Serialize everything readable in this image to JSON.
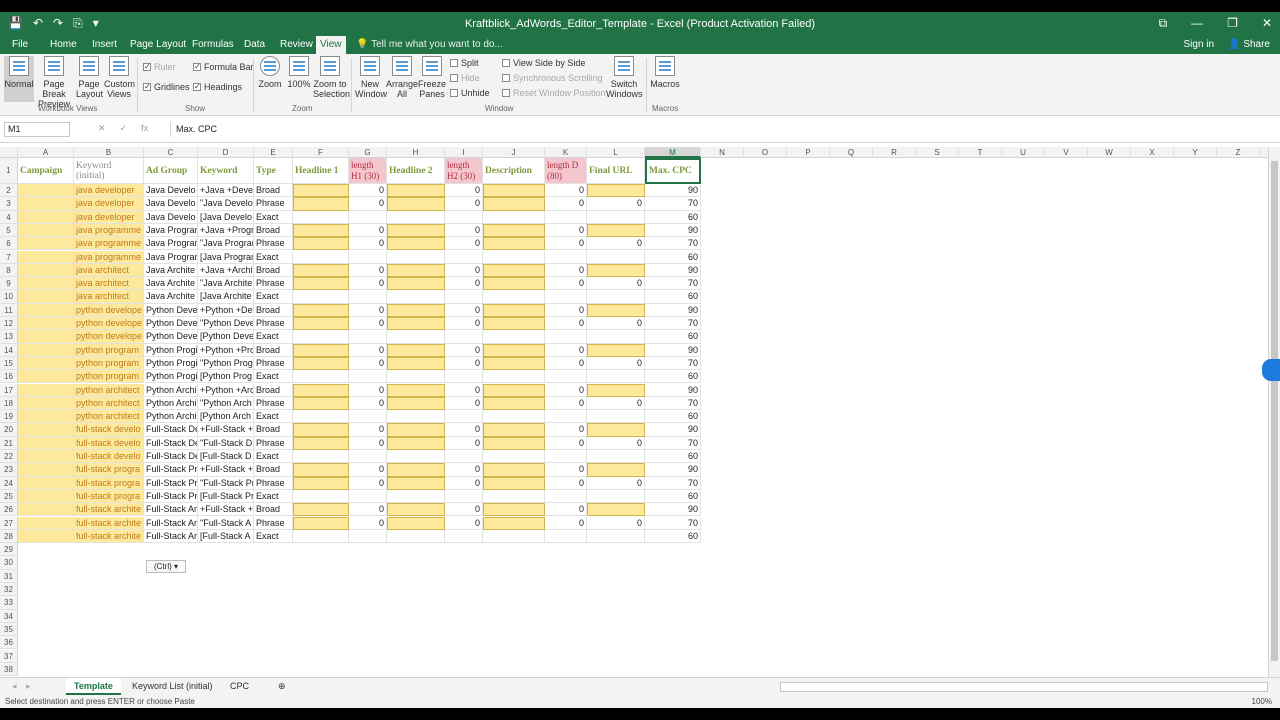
{
  "window": {
    "title": "Kraftblick_AdWords_Editor_Template - Excel (Product Activation Failed)",
    "qat": [
      "💾",
      "↶",
      "↷",
      "⎘",
      "▾"
    ],
    "controls": [
      "⧉",
      "—",
      "❐",
      "✕"
    ]
  },
  "menu": {
    "tabs": [
      "File",
      "Home",
      "Insert",
      "Page Layout",
      "Formulas",
      "Data",
      "Review",
      "View"
    ],
    "active": "View",
    "tell_me": "Tell me what you want to do...",
    "sign_in": "Sign in",
    "share": "Share"
  },
  "ribbon": {
    "workbook_views": [
      "Normal",
      "Page Break Preview",
      "Page Layout",
      "Custom Views"
    ],
    "show": {
      "ruler": "Ruler",
      "formula_bar": "Formula Bar",
      "gridlines": "Gridlines",
      "headings": "Headings"
    },
    "zoom": [
      "Zoom",
      "100%",
      "Zoom to Selection"
    ],
    "window_big": [
      "New Window",
      "Arrange All",
      "Freeze Panes"
    ],
    "window_small": [
      "Split",
      "Hide",
      "Unhide"
    ],
    "window_side": [
      "View Side by Side",
      "Synchronous Scrolling",
      "Reset Window Position"
    ],
    "switch": "Switch Windows",
    "macros": "Macros",
    "groups": [
      "Workbook Views",
      "Show",
      "Zoom",
      "Window",
      "Macros"
    ]
  },
  "formula_bar": {
    "name_box": "M1",
    "content": "Max. CPC",
    "icons": [
      "✕",
      "✓",
      "fx"
    ]
  },
  "columns": [
    "A",
    "B",
    "C",
    "D",
    "E",
    "F",
    "G",
    "H",
    "I",
    "J",
    "K",
    "L",
    "M",
    "N",
    "O",
    "P",
    "Q",
    "R",
    "S",
    "T",
    "U",
    "V",
    "W",
    "X",
    "Y",
    "Z"
  ],
  "headers": {
    "A": "Campaign",
    "B": "Keyword (initial)",
    "C": "Ad Group",
    "D": "Keyword",
    "E": "Type",
    "F": "Headline 1",
    "G": "length H1 (30)",
    "H": "Headline 2",
    "I": "length H2 (30)",
    "J": "Description",
    "K": "length D (80)",
    "L": "Final URL",
    "M": "Max. CPC"
  },
  "rows": [
    {
      "b": "java developer",
      "c": "Java Develo",
      "d": "+Java +Devel",
      "e": "Broad",
      "g": "0",
      "i": "0",
      "k": "0",
      "l": "",
      "m": "90"
    },
    {
      "b": "java developer",
      "c": "Java Develo",
      "d": "\"Java Develo",
      "e": "Phrase",
      "g": "0",
      "i": "0",
      "k": "0",
      "l": "0",
      "m": "70"
    },
    {
      "b": "java developer",
      "c": "Java Develo",
      "d": "[Java Develo",
      "e": "Exact",
      "g": "",
      "i": "",
      "k": "",
      "l": "",
      "m": "60"
    },
    {
      "b": "java programme",
      "c": "Java Progran",
      "d": "+Java +Progr",
      "e": "Broad",
      "g": "0",
      "i": "0",
      "k": "0",
      "l": "",
      "m": "90"
    },
    {
      "b": "java programme",
      "c": "Java Progran",
      "d": "\"Java Progran",
      "e": "Phrase",
      "g": "0",
      "i": "0",
      "k": "0",
      "l": "0",
      "m": "70"
    },
    {
      "b": "java programme",
      "c": "Java Progran",
      "d": "[Java Progran",
      "e": "Exact",
      "g": "",
      "i": "",
      "k": "",
      "l": "",
      "m": "60"
    },
    {
      "b": "java architect",
      "c": "Java Archite",
      "d": "+Java +Archit",
      "e": "Broad",
      "g": "0",
      "i": "0",
      "k": "0",
      "l": "",
      "m": "90"
    },
    {
      "b": "java architect",
      "c": "Java Archite",
      "d": "\"Java Archite",
      "e": "Phrase",
      "g": "0",
      "i": "0",
      "k": "0",
      "l": "0",
      "m": "70"
    },
    {
      "b": "java architect",
      "c": "Java Archite",
      "d": "[Java Archite",
      "e": "Exact",
      "g": "",
      "i": "",
      "k": "",
      "l": "",
      "m": "60"
    },
    {
      "b": "python develope",
      "c": "Python Deve",
      "d": "+Python +Dev",
      "e": "Broad",
      "g": "0",
      "i": "0",
      "k": "0",
      "l": "",
      "m": "90"
    },
    {
      "b": "python develope",
      "c": "Python Deve",
      "d": "\"Python Deve",
      "e": "Phrase",
      "g": "0",
      "i": "0",
      "k": "0",
      "l": "0",
      "m": "70"
    },
    {
      "b": "python develope",
      "c": "Python Deve",
      "d": "[Python Deve",
      "e": "Exact",
      "g": "",
      "i": "",
      "k": "",
      "l": "",
      "m": "60"
    },
    {
      "b": "python program",
      "c": "Python Progi",
      "d": "+Python +Pro",
      "e": "Broad",
      "g": "0",
      "i": "0",
      "k": "0",
      "l": "",
      "m": "90"
    },
    {
      "b": "python program",
      "c": "Python Progi",
      "d": "\"Python Prog",
      "e": "Phrase",
      "g": "0",
      "i": "0",
      "k": "0",
      "l": "0",
      "m": "70"
    },
    {
      "b": "python program",
      "c": "Python Progi",
      "d": "[Python Prog",
      "e": "Exact",
      "g": "",
      "i": "",
      "k": "",
      "l": "",
      "m": "60"
    },
    {
      "b": "python architect",
      "c": "Python Archi",
      "d": "+Python +Arc",
      "e": "Broad",
      "g": "0",
      "i": "0",
      "k": "0",
      "l": "",
      "m": "90"
    },
    {
      "b": "python architect",
      "c": "Python Archi",
      "d": "\"Python Arch",
      "e": "Phrase",
      "g": "0",
      "i": "0",
      "k": "0",
      "l": "0",
      "m": "70"
    },
    {
      "b": "python architect",
      "c": "Python Archi",
      "d": "[Python Arch",
      "e": "Exact",
      "g": "",
      "i": "",
      "k": "",
      "l": "",
      "m": "60"
    },
    {
      "b": "full-stack develo",
      "c": "Full-Stack De",
      "d": "+Full-Stack +l",
      "e": "Broad",
      "g": "0",
      "i": "0",
      "k": "0",
      "l": "",
      "m": "90"
    },
    {
      "b": "full-stack develo",
      "c": "Full-Stack De",
      "d": "\"Full-Stack D",
      "e": "Phrase",
      "g": "0",
      "i": "0",
      "k": "0",
      "l": "0",
      "m": "70"
    },
    {
      "b": "full-stack develo",
      "c": "Full-Stack De",
      "d": "[Full-Stack D",
      "e": "Exact",
      "g": "",
      "i": "",
      "k": "",
      "l": "",
      "m": "60"
    },
    {
      "b": "full-stack progra",
      "c": "Full-Stack Pr",
      "d": "+Full-Stack +l",
      "e": "Broad",
      "g": "0",
      "i": "0",
      "k": "0",
      "l": "",
      "m": "90"
    },
    {
      "b": "full-stack progra",
      "c": "Full-Stack Pr",
      "d": "\"Full-Stack Pr",
      "e": "Phrase",
      "g": "0",
      "i": "0",
      "k": "0",
      "l": "0",
      "m": "70"
    },
    {
      "b": "full-stack progra",
      "c": "Full-Stack Pr",
      "d": "[Full-Stack Pr",
      "e": "Exact",
      "g": "",
      "i": "",
      "k": "",
      "l": "",
      "m": "60"
    },
    {
      "b": "full-stack archite",
      "c": "Full-Stack Ar",
      "d": "+Full-Stack +",
      "e": "Broad",
      "g": "0",
      "i": "0",
      "k": "0",
      "l": "",
      "m": "90"
    },
    {
      "b": "full-stack archite",
      "c": "Full-Stack Ar",
      "d": "\"Full-Stack A",
      "e": "Phrase",
      "g": "0",
      "i": "0",
      "k": "0",
      "l": "0",
      "m": "70"
    },
    {
      "b": "full-stack archite",
      "c": "Full-Stack Ar",
      "d": "[Full-Stack A",
      "e": "Exact",
      "g": "",
      "i": "",
      "k": "",
      "l": "",
      "m": "60"
    }
  ],
  "row_numbers": [
    "1",
    "2",
    "3",
    "4",
    "5",
    "6",
    "7",
    "8",
    "9",
    "10",
    "11",
    "12",
    "13",
    "14",
    "15",
    "16",
    "17",
    "18",
    "19",
    "20",
    "21",
    "22",
    "23",
    "24",
    "25",
    "26",
    "27",
    "28",
    "29",
    "30",
    "31",
    "32",
    "33",
    "34",
    "35",
    "36",
    "37",
    "38"
  ],
  "paste_options": "(Ctrl) ▾",
  "sheets": [
    "Template",
    "Keyword List (initial)",
    "CPC"
  ],
  "active_sheet": "Template",
  "add_sheet": "⊕",
  "status": "Select destination and press ENTER or choose Paste",
  "zoom_level": "100%",
  "colors": {
    "excel_green": "#217346",
    "fill_yellow": "#fde99b",
    "fill_pink": "#f4c7cf",
    "header_green": "#7f9a3c",
    "text_orange": "#c07a1c"
  }
}
